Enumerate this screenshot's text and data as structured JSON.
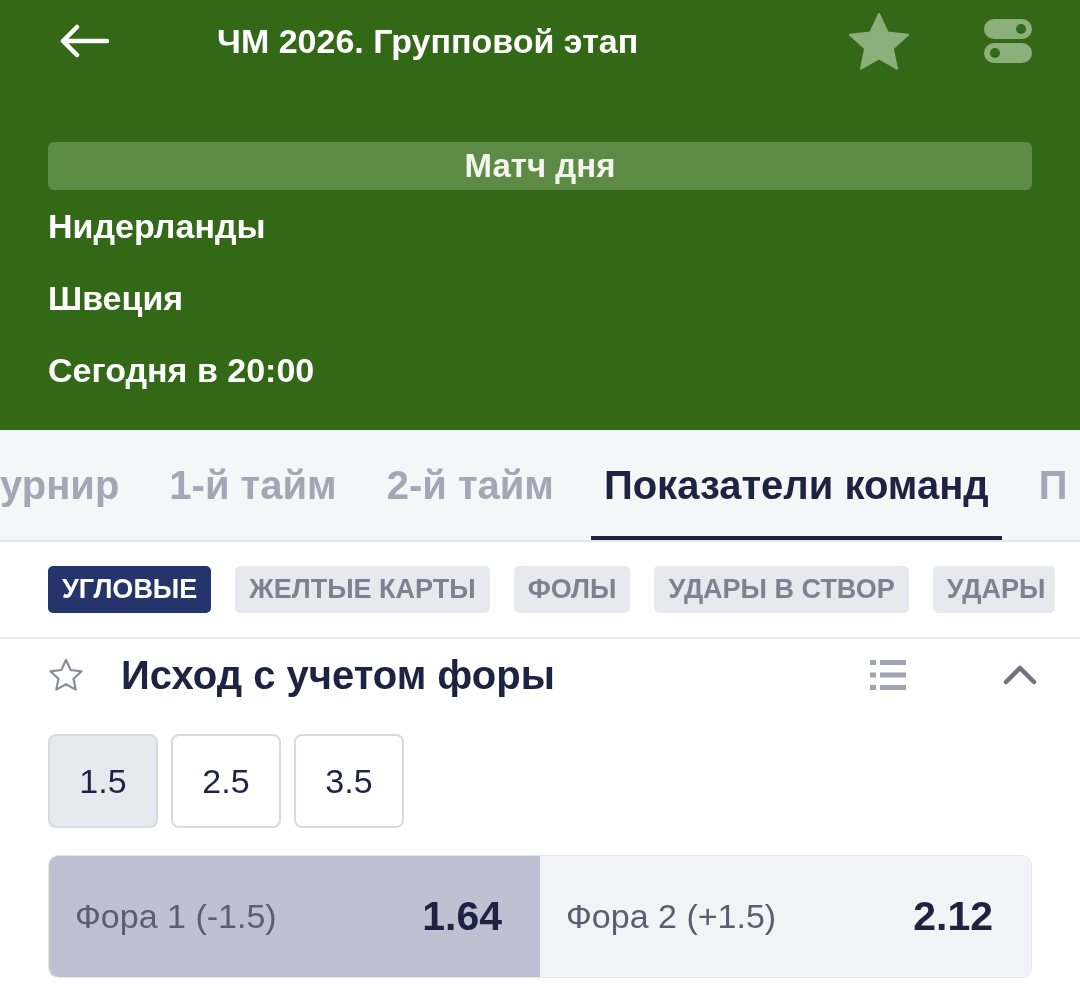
{
  "header": {
    "title": "ЧМ 2026. Групповой этап"
  },
  "match": {
    "banner": "Матч дня",
    "team_1": "Нидерланды",
    "team_2": "Швеция",
    "start_time": "Сегодня в 20:00"
  },
  "tabs": [
    {
      "label": "урнир",
      "selected": false
    },
    {
      "label": "1-й тайм",
      "selected": false
    },
    {
      "label": "2-й тайм",
      "selected": false
    },
    {
      "label": "Показатели команд",
      "selected": true
    },
    {
      "label": "П",
      "selected": false
    }
  ],
  "categories": [
    {
      "label": "УГЛОВЫЕ",
      "selected": true
    },
    {
      "label": "ЖЕЛТЫЕ КАРТЫ",
      "selected": false
    },
    {
      "label": "ФОЛЫ",
      "selected": false
    },
    {
      "label": "УДАРЫ В СТВОР",
      "selected": false
    },
    {
      "label": "УДАРЫ",
      "selected": false
    }
  ],
  "market": {
    "title": "Исход с учетом форы",
    "favorite": false,
    "expanded": true,
    "lines": [
      {
        "label": "1.5",
        "selected": true
      },
      {
        "label": "2.5",
        "selected": false
      },
      {
        "label": "3.5",
        "selected": false
      }
    ],
    "outcomes": [
      {
        "label": "Фора 1 (-1.5)",
        "odds": "1.64",
        "selected": true
      },
      {
        "label": "Фора 2 (+1.5)",
        "odds": "2.12",
        "selected": false
      }
    ]
  }
}
